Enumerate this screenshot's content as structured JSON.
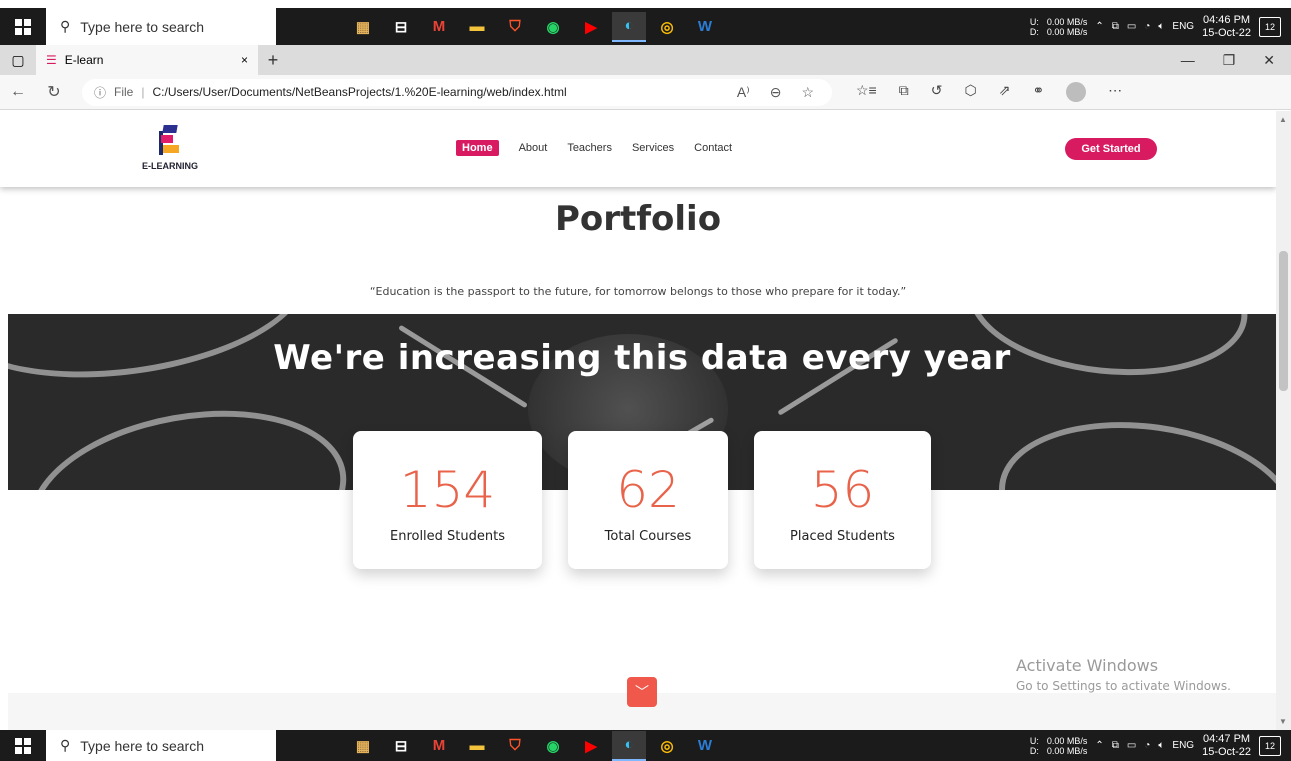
{
  "taskbar_top": {
    "search_placeholder": "Type here to search",
    "apps": [
      "folder-app",
      "task-view",
      "gmail",
      "file-explorer",
      "brave",
      "whatsapp",
      "youtube",
      "edge",
      "chrome",
      "word"
    ],
    "net_up": "0.00 MB/s",
    "net_down": "0.00 MB/s",
    "u_label": "U:",
    "d_label": "D:",
    "lang": "ENG",
    "time": "04:46 PM",
    "date": "15-Oct-22",
    "notif_count": "12"
  },
  "taskbar_bottom": {
    "search_placeholder": "Type here to search",
    "net_up": "0.00 MB/s",
    "net_down": "0.00 MB/s",
    "u_label": "U:",
    "d_label": "D:",
    "lang": "ENG",
    "time": "04:47 PM",
    "date": "15-Oct-22",
    "notif_count": "12"
  },
  "browser": {
    "tab_title": "E-learn",
    "new_tab": "+",
    "close_tab": "×",
    "url_prefix": "File",
    "url": "C:/Users/User/Documents/NetBeansProjects/1.%20E-learning/web/index.html"
  },
  "site": {
    "logo_text": "E-LEARNING",
    "nav": [
      "Home",
      "About",
      "Teachers",
      "Services",
      "Contact"
    ],
    "cta": "Get Started",
    "section_title": "Portfolio",
    "quote": "“Education is the passport to the future, for tomorrow belongs to those who prepare for it today.”",
    "banner_title": "We're increasing this data every year",
    "stats": [
      {
        "value": "154",
        "label": "Enrolled Students"
      },
      {
        "value": "62",
        "label": "Total Courses"
      },
      {
        "value": "56",
        "label": "Placed Students"
      }
    ]
  },
  "watermark": {
    "line1": "Activate Windows",
    "line2": "Go to Settings to activate Windows."
  },
  "colors": {
    "brand_pink": "#d81b60",
    "stat_orange": "#e8634a",
    "scroll_button": "#f0584c"
  }
}
